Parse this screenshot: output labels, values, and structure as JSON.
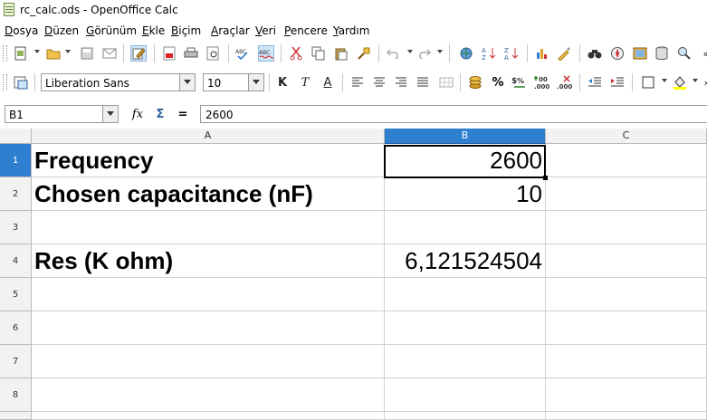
{
  "window": {
    "title": "rc_calc.ods - OpenOffice Calc"
  },
  "menu": [
    "Dosya",
    "Düzen",
    "Görünüm",
    "Ekle",
    "Biçim",
    "Araçlar",
    "Veri",
    "Pencere",
    "Yardım"
  ],
  "format_toolbar": {
    "font_name": "Liberation Sans",
    "font_size": "10",
    "bold_label": "K",
    "italic_label": "T",
    "underline_label": "A",
    "percent_label": "%"
  },
  "formula_bar": {
    "name_box": "B1",
    "input": "2600"
  },
  "grid": {
    "columns": [
      "A",
      "B",
      "C"
    ],
    "rows": [
      "1",
      "2",
      "3",
      "4",
      "5",
      "6",
      "7",
      "8"
    ],
    "cells": {
      "A1": "Frequency",
      "B1": "2600",
      "A2": "Chosen capacitance (nF)",
      "B2": "10",
      "A4": "Res (K ohm)",
      "B4": "6,121524504"
    }
  },
  "colors": {
    "selection_header": "#2f7fd0",
    "grid_line": "#d0d0d0",
    "header_bg": "#f2f2f2"
  }
}
